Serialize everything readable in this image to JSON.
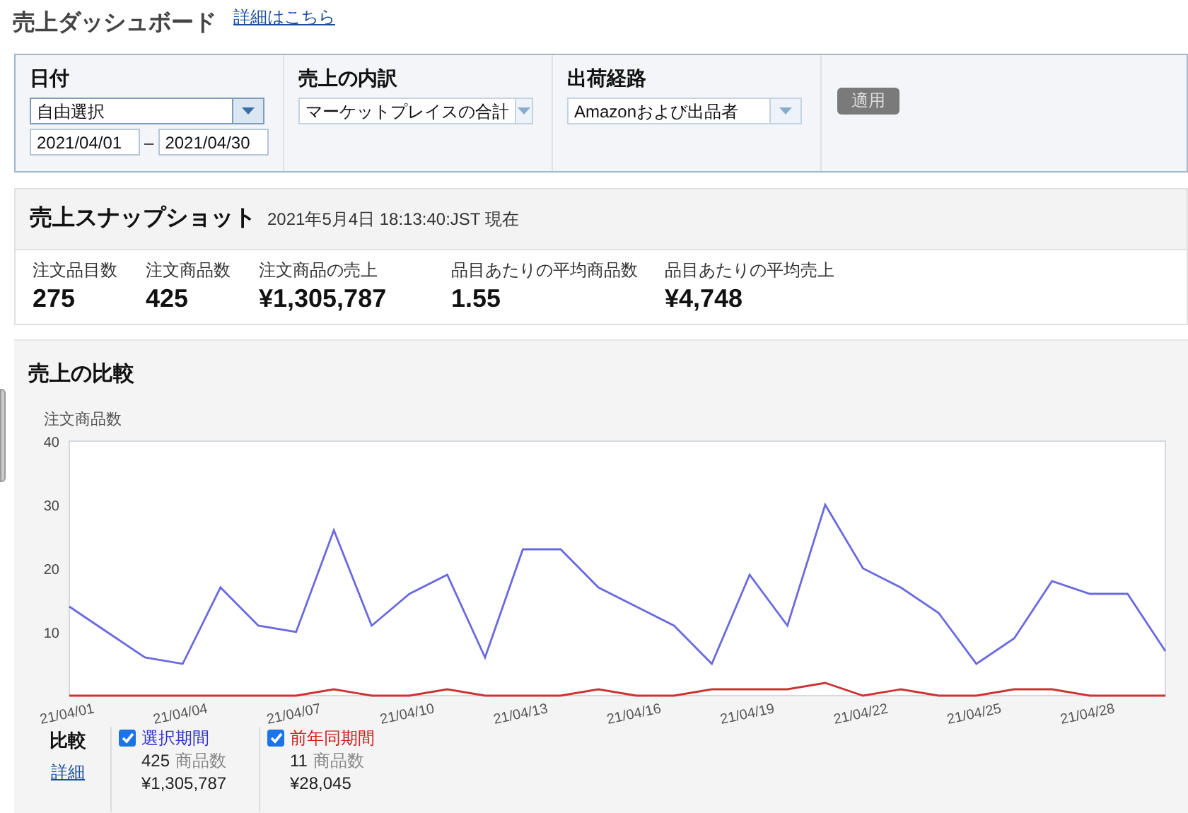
{
  "page": {
    "title": "売上ダッシュボード",
    "link": "詳細はこちら"
  },
  "filters": {
    "groups": [
      {
        "label": "日付",
        "dropdown": {
          "value": "自由選択",
          "emphasis": true
        },
        "date_from": "2021/04/01",
        "separator": "–",
        "date_to": "2021/04/30"
      },
      {
        "label": "売上の内訳",
        "dropdown": {
          "value": "マーケットプレイスの合計",
          "emphasis": false
        }
      },
      {
        "label": "出荷経路",
        "dropdown": {
          "value": "Amazonおよび出品者",
          "emphasis": false
        }
      }
    ],
    "apply_button": {
      "label": "適用",
      "disabled": true
    }
  },
  "snapshot": {
    "title": "売上スナップショット",
    "timestamp": "2021年5月4日 18:13:40:JST 現在",
    "metrics": [
      {
        "label": "注文品目数",
        "value": "275"
      },
      {
        "label": "注文商品数",
        "value": "425"
      },
      {
        "label": "注文商品の売上",
        "value": "¥1,305,787"
      },
      {
        "label": "品目あたりの平均商品数",
        "value": "1.55"
      },
      {
        "label": "品目あたりの平均売上",
        "value": "¥4,748"
      }
    ]
  },
  "comparison": {
    "title": "売上の比較",
    "chart_data": {
      "type": "line",
      "ylabel": "注文商品数",
      "categories": [
        "21/04/01",
        null,
        null,
        "21/04/04",
        null,
        null,
        "21/04/07",
        null,
        null,
        "21/04/10",
        null,
        null,
        "21/04/13",
        null,
        null,
        "21/04/16",
        null,
        null,
        "21/04/19",
        null,
        null,
        "21/04/22",
        null,
        null,
        "21/04/25",
        null,
        null,
        "21/04/28",
        null,
        null
      ],
      "series": [
        {
          "name": "選択期間",
          "color": "#6a6ae0",
          "values": [
            14,
            10,
            6,
            5,
            17,
            11,
            10,
            26,
            11,
            16,
            19,
            6,
            23,
            23,
            17,
            14,
            11,
            5,
            19,
            11,
            30,
            20,
            17,
            13,
            5,
            9,
            18,
            16,
            16,
            7
          ]
        },
        {
          "name": "前年同期間",
          "color": "#cc3333",
          "values": [
            0,
            0,
            0,
            0,
            0,
            0,
            0,
            1,
            0,
            0,
            1,
            0,
            0,
            0,
            1,
            0,
            0,
            1,
            1,
            1,
            2,
            0,
            1,
            0,
            0,
            1,
            1,
            0,
            0,
            0
          ]
        }
      ],
      "ylim": [
        0,
        40
      ],
      "yticks": [
        10,
        20,
        30,
        40
      ]
    },
    "legend": {
      "title": "比較",
      "link": "詳細",
      "items": [
        {
          "checked": true,
          "color": "#3333cc",
          "units": "425",
          "units_label": "商品数",
          "sales": "¥1,305,787"
        },
        {
          "checked": true,
          "color": "#cc2222",
          "units": "11",
          "units_label": "商品数",
          "sales": "¥28,045"
        }
      ]
    }
  }
}
